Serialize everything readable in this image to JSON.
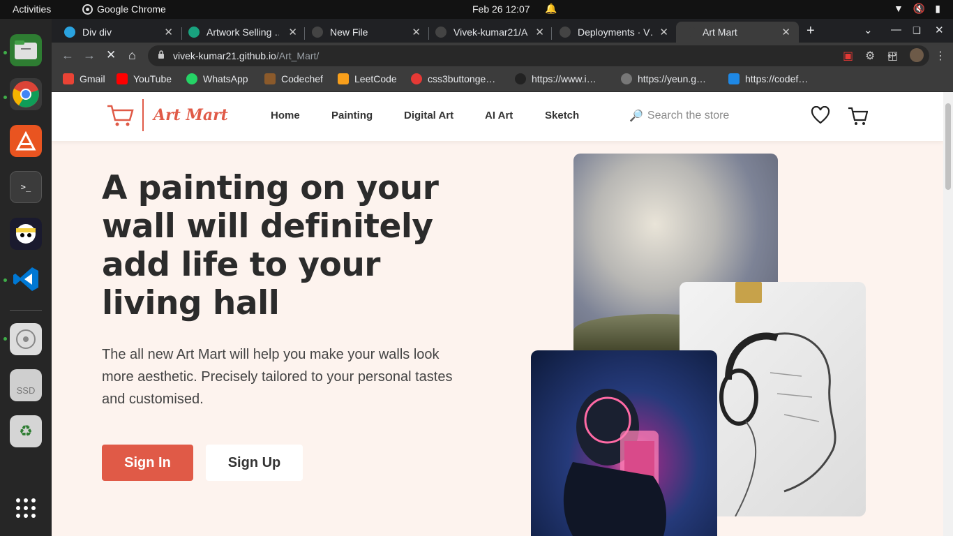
{
  "topbar": {
    "activities": "Activities",
    "app_name": "Google Chrome",
    "clock": "Feb 26  12:07"
  },
  "tabs": [
    {
      "title": "Div div",
      "favicon_color": "#2aa3e0"
    },
    {
      "title": "Artwork Selling …",
      "favicon_color": "#19a37f"
    },
    {
      "title": "New File",
      "favicon_color": "#444"
    },
    {
      "title": "Vivek-kumar21/A…",
      "favicon_color": "#444"
    },
    {
      "title": "Deployments · V…",
      "favicon_color": "#444"
    },
    {
      "title": "Art Mart",
      "favicon_color": "#3c3c3c",
      "active": true
    }
  ],
  "omnibox": {
    "host": "vivek-kumar21.github.io",
    "path": "/Art_Mart/"
  },
  "bookmarks": [
    {
      "label": "Gmail",
      "color": "#ea4335"
    },
    {
      "label": "YouTube",
      "color": "#ff0000"
    },
    {
      "label": "WhatsApp",
      "color": "#25d366"
    },
    {
      "label": "Codechef",
      "color": "#8b5a2b"
    },
    {
      "label": "LeetCode",
      "color": "#f89f1b"
    },
    {
      "label": "css3buttonge…",
      "color": "#e53935"
    },
    {
      "label": "https://www.i…",
      "color": "#222"
    },
    {
      "label": "https://yeun.g…",
      "color": "#777"
    },
    {
      "label": "https://codef…",
      "color": "#1e88e5"
    }
  ],
  "site": {
    "brand": "Art Mart",
    "nav": [
      "Home",
      "Painting",
      "Digital Art",
      "AI Art",
      "Sketch"
    ],
    "search_placeholder": "Search the store",
    "hero_title": "A painting on your wall will definitely add life to your living hall",
    "hero_text": "The all new Art Mart will help you make your walls look more aesthetic. Precisely tailored to your personal tastes and customised.",
    "signin_label": "Sign In",
    "signup_label": "Sign Up",
    "accent": "#e05a47",
    "background": "#fdf3ee"
  }
}
